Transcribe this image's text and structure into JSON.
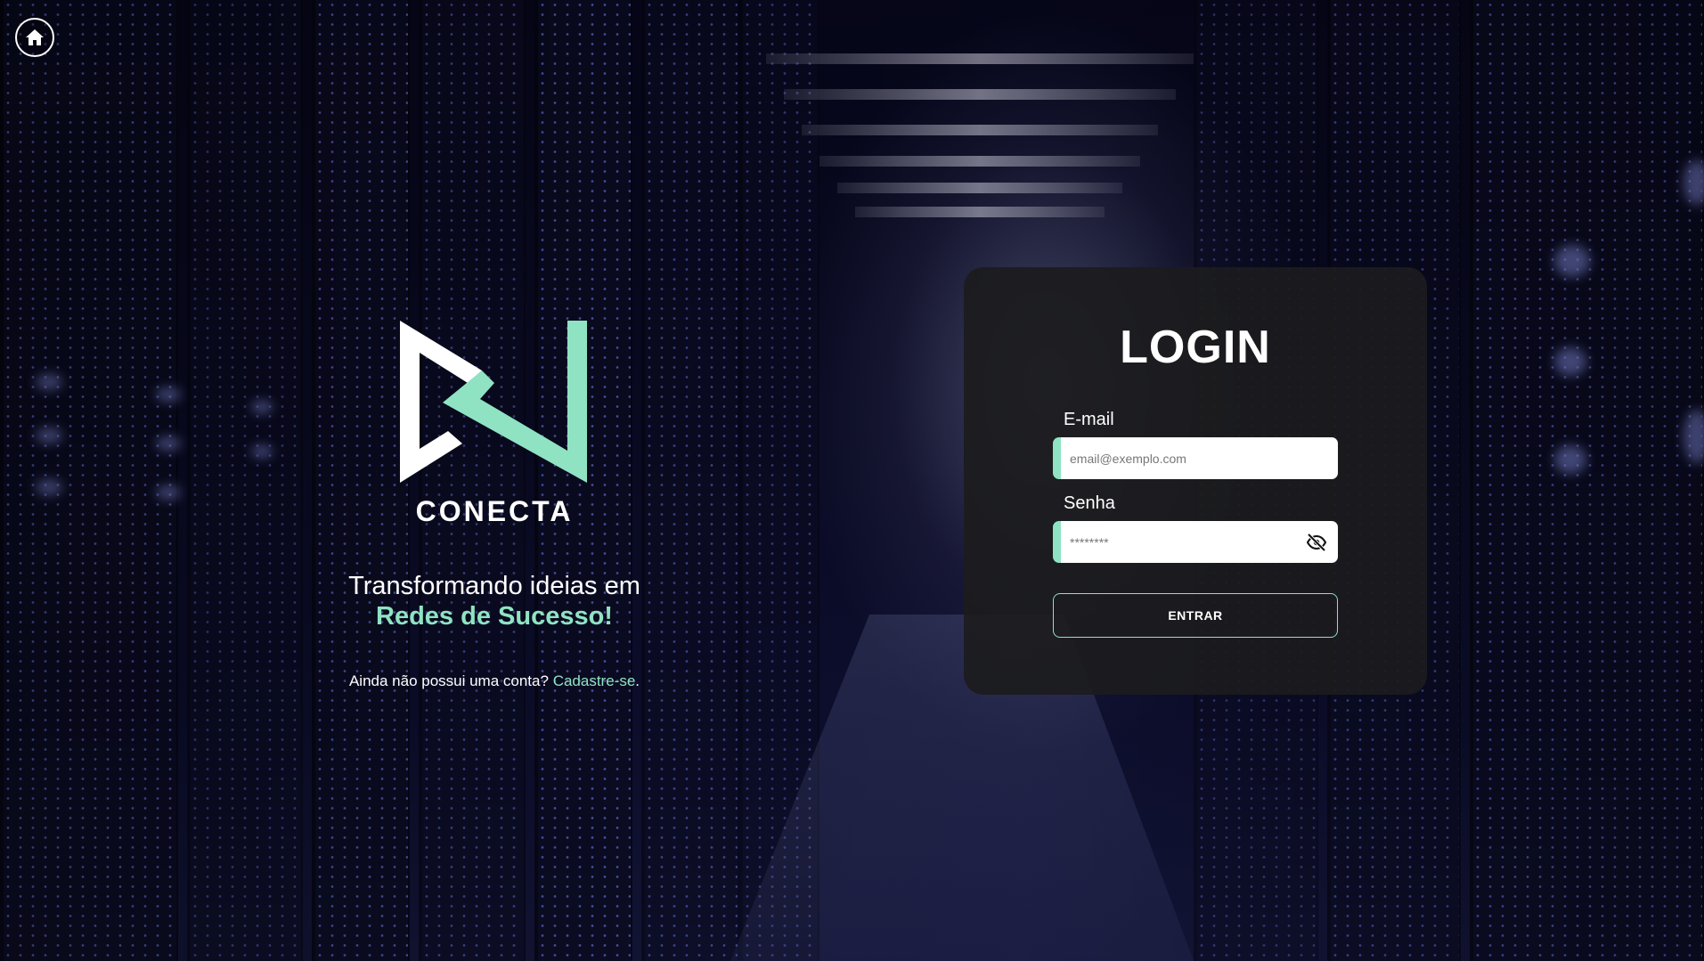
{
  "brand": {
    "name": "CONECTA",
    "tagline_line1": "Transformando ideias em",
    "tagline_line2": "Redes de Sucesso!",
    "signup_prompt": "Ainda não possui uma conta?",
    "signup_link": "Cadastre-se",
    "signup_suffix": "."
  },
  "login": {
    "title": "LOGIN",
    "email_label": "E-mail",
    "email_placeholder": "email@exemplo.com",
    "password_label": "Senha",
    "password_placeholder": "********",
    "submit_label": "ENTRAR"
  },
  "icons": {
    "home": "home-icon",
    "password_toggle": "eye-slash-icon"
  },
  "colors": {
    "accent": "#8fe3c3",
    "card": "#1c1c1e",
    "text": "#ffffff"
  }
}
